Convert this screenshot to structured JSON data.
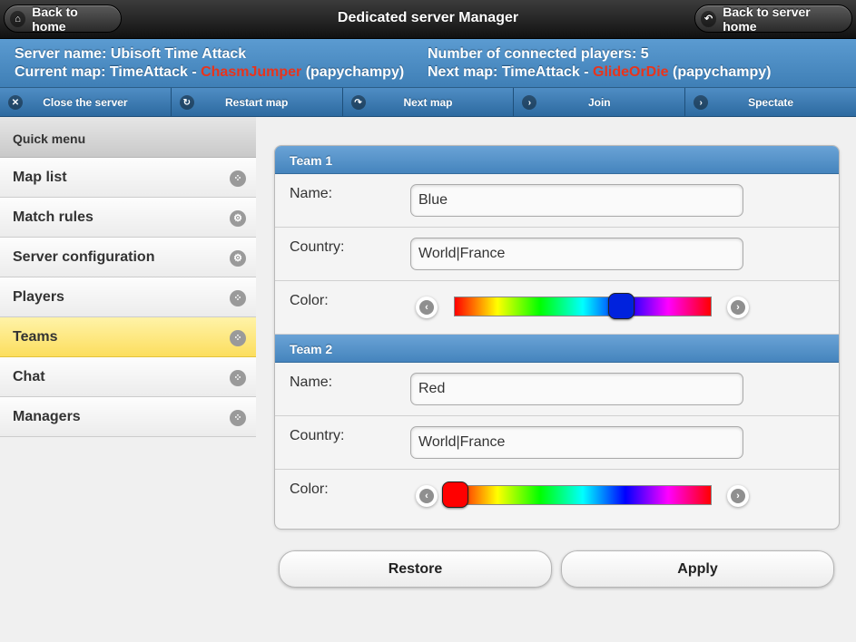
{
  "header": {
    "title": "Dedicated server Manager",
    "back_home": "Back to home",
    "back_server_home": "Back to server home",
    "home_icon": "home-icon",
    "back_icon": "back-icon"
  },
  "info": {
    "server_name_label": "Server name:",
    "server_name": "Ubisoft Time Attack",
    "current_map_label": "Current map:",
    "current_map_prefix": "TimeAttack -",
    "current_map_name": "ChasmJumper",
    "current_map_author": "(papychampy)",
    "players_label": "Number of connected players:",
    "players_count": "5",
    "next_map_label": "Next map:",
    "next_map_prefix": "TimeAttack -",
    "next_map_name": "GlideOrDie",
    "next_map_author": "(papychampy)",
    "map_name_color": "#e8341c"
  },
  "actions": [
    {
      "label": "Close the server",
      "icon": "close-icon"
    },
    {
      "label": "Restart map",
      "icon": "refresh-icon"
    },
    {
      "label": "Next map",
      "icon": "redo-icon"
    },
    {
      "label": "Join",
      "icon": "arrow-right-icon"
    },
    {
      "label": "Spectate",
      "icon": "arrow-right-icon"
    }
  ],
  "sidebar": {
    "heading": "Quick menu",
    "items": [
      {
        "label": "Map list",
        "icon": "grid-icon"
      },
      {
        "label": "Match rules",
        "icon": "gear-icon"
      },
      {
        "label": "Server configuration",
        "icon": "gear-icon"
      },
      {
        "label": "Players",
        "icon": "grid-icon"
      },
      {
        "label": "Teams",
        "icon": "grid-icon",
        "active": true
      },
      {
        "label": "Chat",
        "icon": "grid-icon"
      },
      {
        "label": "Managers",
        "icon": "grid-icon"
      }
    ]
  },
  "teams": [
    {
      "title": "Team 1",
      "name_label": "Name:",
      "name": "Blue",
      "country_label": "Country:",
      "country": "World|France",
      "color_label": "Color:",
      "color_hex": "#0022dd",
      "color_position": 0.65
    },
    {
      "title": "Team 2",
      "name_label": "Name:",
      "name": "Red",
      "country_label": "Country:",
      "country": "World|France",
      "color_label": "Color:",
      "color_hex": "#ff0000",
      "color_position": 0.0
    }
  ],
  "buttons": {
    "restore": "Restore",
    "apply": "Apply"
  },
  "colors": {
    "accent_blue": "#4584bd",
    "active_yellow": "#fcde5e"
  }
}
